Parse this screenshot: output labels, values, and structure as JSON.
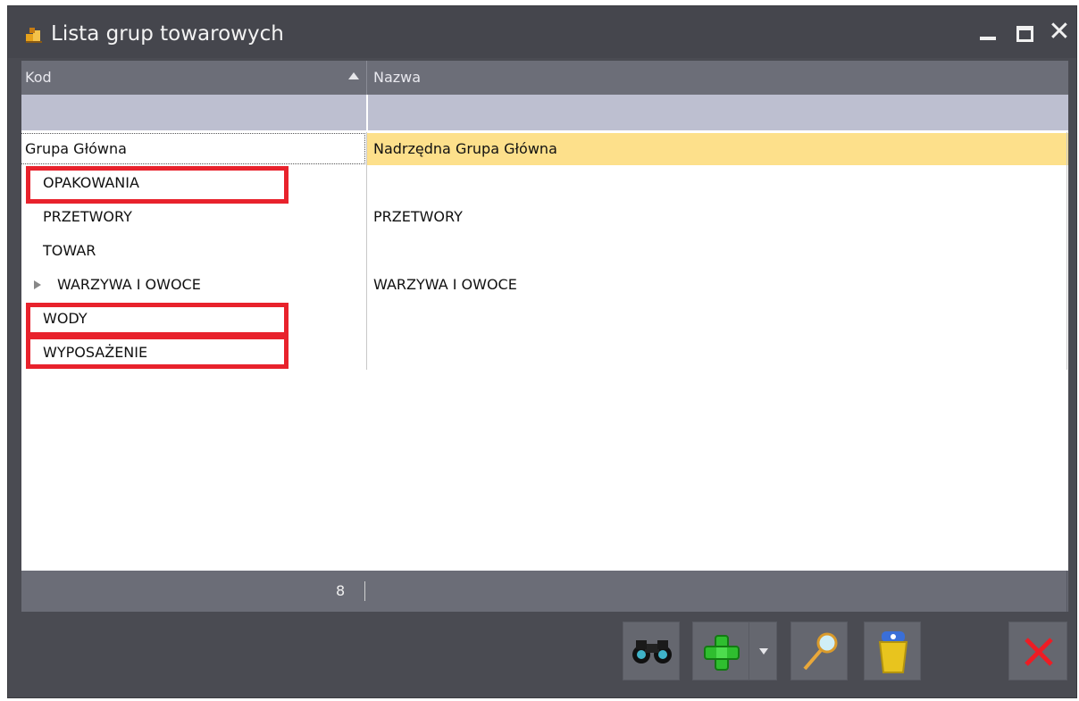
{
  "window": {
    "title": "Lista grup towarowych",
    "close_glyph": "✕"
  },
  "grid": {
    "columns": [
      "Kod",
      "Nazwa"
    ],
    "sort_column": "Kod",
    "rows": [
      {
        "kod": "Grupa Główna",
        "nazwa": "Nadrzędna Grupa Główna",
        "selected": true
      },
      {
        "kod": "OPAKOWANIA",
        "nazwa": ""
      },
      {
        "kod": "PRZETWORY",
        "nazwa": "PRZETWORY"
      },
      {
        "kod": "TOWAR",
        "nazwa": ""
      },
      {
        "kod": "WARZYWA I OWOCE",
        "nazwa": "WARZYWA I OWOCE",
        "expandable": true
      },
      {
        "kod": "WODY",
        "nazwa": ""
      },
      {
        "kod": "WYPOSAŻENIE",
        "nazwa": ""
      }
    ],
    "footer_count": "8"
  },
  "toolbar": {
    "buttons": [
      "binoculars-icon",
      "add-icon",
      "dropdown-arrow-icon",
      "magnifier-icon",
      "trash-icon",
      "close-icon"
    ]
  },
  "colors": {
    "highlight": "#e8222c",
    "selection": "#fde08b",
    "header": "#6c6e78",
    "window": "#4a4b52"
  }
}
